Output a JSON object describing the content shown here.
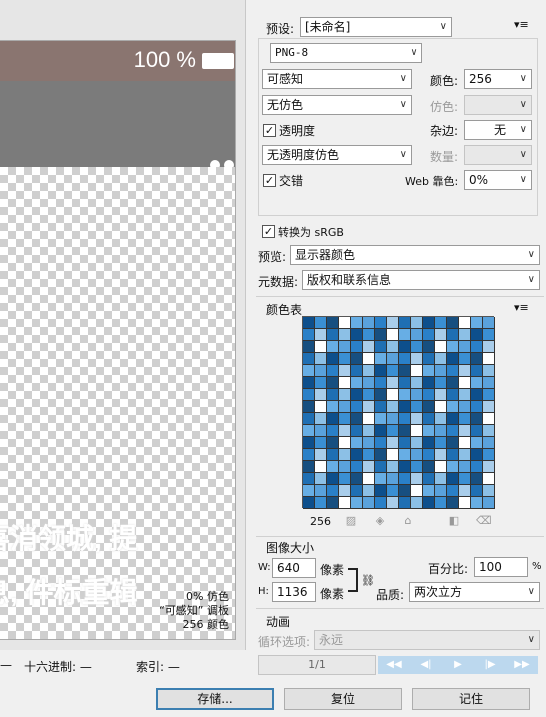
{
  "preview": {
    "battery": "100 %",
    "info_lines": [
      "0% 仿色",
      "“可感知” 调板",
      "256 颜色"
    ],
    "ghost_text_1": "喜消领城, 提",
    "ghost_text_2": "息, 件标重辑"
  },
  "status_bar": {
    "hex_label": "十六进制: —",
    "index_label": "索引: —",
    "lead": "—"
  },
  "settings": {
    "preset_label": "预设:",
    "preset_value": "[未命名]",
    "format_value": "PNG-8",
    "reduction_value": "可感知",
    "colors_label": "颜色:",
    "colors_value": "256",
    "dither_value": "无仿色",
    "dither_amount_label": "仿色:",
    "transparency_label": "透明度",
    "matte_label": "杂边:",
    "matte_value": "无",
    "transparency_dither_value": "无透明度仿色",
    "amount_label": "数量:",
    "interlaced_label": "交错",
    "web_snap_label": "Web 靠色:",
    "web_snap_value": "0%",
    "convert_srgb_label": "转换为 sRGB",
    "preview_label": "预览:",
    "preview_value": "显示器颜色",
    "metadata_label": "元数据:",
    "metadata_value": "版权和联系信息"
  },
  "color_table": {
    "title": "颜色表",
    "count": "256",
    "colors": [
      "#1f6fb3",
      "#3a8fd3",
      "#67aee5",
      "#a9cdea",
      "#0d4f8c",
      "#ffffff",
      "#2a80c8",
      "#8cc0e6",
      "#174f80",
      "#5aa2dc"
    ]
  },
  "image_size": {
    "title": "图像大小",
    "w_label": "W:",
    "w_value": "640",
    "h_label": "H:",
    "h_value": "1136",
    "unit": "像素",
    "percent_label": "百分比:",
    "percent_value": "100",
    "percent_unit": "%",
    "quality_label": "品质:",
    "quality_value": "两次立方"
  },
  "animation": {
    "title": "动画",
    "loop_label": "循环选项:",
    "loop_value": "永远",
    "frame": "1/1"
  },
  "buttons": {
    "save": "存储...",
    "reset": "复位",
    "remember": "记住"
  }
}
